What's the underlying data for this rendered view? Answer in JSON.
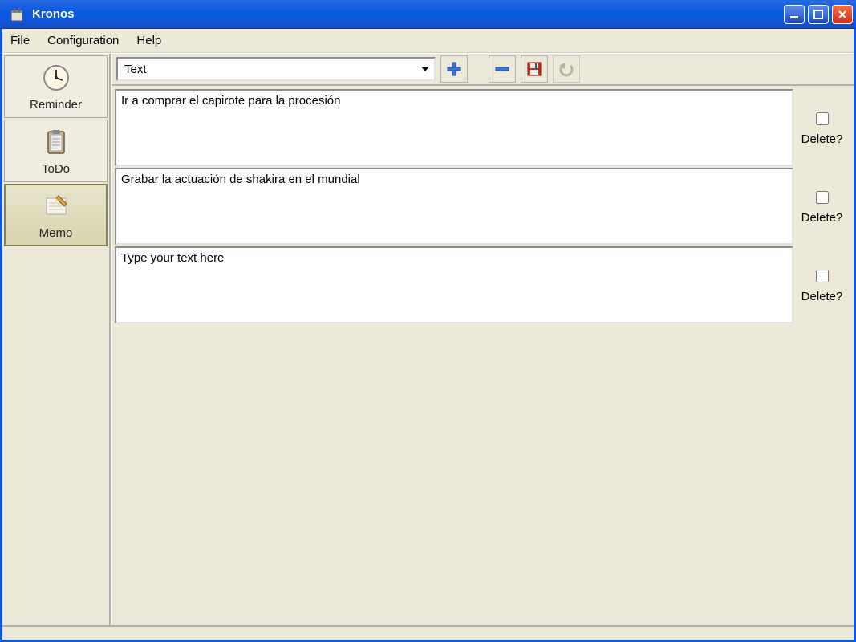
{
  "window": {
    "title": "Kronos"
  },
  "menubar": {
    "file": "File",
    "configuration": "Configuration",
    "help": "Help"
  },
  "sidebar": {
    "reminder": "Reminder",
    "todo": "ToDo",
    "memo": "Memo"
  },
  "toolbar": {
    "combo_value": "Text"
  },
  "memos": [
    {
      "text": "Ir a comprar el capirote para la procesión",
      "delete_label": "Delete?"
    },
    {
      "text": "Grabar la actuación de shakira en el mundial",
      "delete_label": "Delete?"
    },
    {
      "text": "Type your text here",
      "delete_label": "Delete?"
    }
  ]
}
